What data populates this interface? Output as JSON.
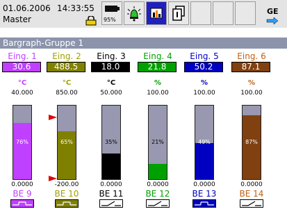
{
  "status": {
    "date": "01.06.2006",
    "time": "14:33:55",
    "user": "Master",
    "battery_percent": "95%",
    "logo_text": "GE"
  },
  "icons": {
    "lock": "lock-icon",
    "battery": "battery-icon",
    "alarm": "alarm-bell-icon",
    "bargraph_view": "bargraph-view-icon",
    "windows": "window-switch-icon"
  },
  "group": {
    "title": "Bargraph-Gruppe 1"
  },
  "channels": [
    {
      "label": "Eing. 1",
      "value": "30.6",
      "unit": "°C",
      "max": "40.000",
      "min": "0.0000",
      "percent_text": "76%",
      "fill_fraction": 0.76,
      "be": "BE 9",
      "color": "#c040ff",
      "label_color": "#c040ff",
      "relay": "nc"
    },
    {
      "label": "Eing. 2",
      "value": "488.5",
      "unit": "°C",
      "max": "850.00",
      "min": "-200.00",
      "percent_text": "65%",
      "fill_fraction": 0.65,
      "be": "BE 10",
      "color": "#808000",
      "label_color": "#a0a000",
      "relay": "nc"
    },
    {
      "label": "Eing. 3",
      "value": "18.0",
      "unit": "°C",
      "max": "50.000",
      "min": "0.0000",
      "percent_text": "35%",
      "fill_fraction": 0.35,
      "be": "BE 11",
      "color": "#000000",
      "label_color": "#000000",
      "relay": "no"
    },
    {
      "label": "Eing. 4",
      "value": "21.8",
      "unit": "%",
      "max": "100.00",
      "min": "0.0000",
      "percent_text": "21%",
      "fill_fraction": 0.21,
      "be": "BE 12",
      "color": "#00a000",
      "label_color": "#00a000",
      "relay": "no"
    },
    {
      "label": "Eing. 5",
      "value": "50.2",
      "unit": "%",
      "max": "100.00",
      "min": "0.0000",
      "percent_text": "49%",
      "fill_fraction": 0.49,
      "be": "BE 13",
      "color": "#0000c0",
      "label_color": "#0000c0",
      "relay": "nc"
    },
    {
      "label": "Eing. 6",
      "value": "87.1",
      "unit": "%",
      "max": "100.00",
      "min": "0.0000",
      "percent_text": "87%",
      "fill_fraction": 0.87,
      "be": "BE 14",
      "color": "#804010",
      "label_color": "#c06010",
      "relay": "no"
    }
  ],
  "colors": {
    "topbar": "#e4e4e4",
    "group_header": "#8c94ac",
    "bar_background": "#9898b0",
    "limit_marker": "#e00000"
  }
}
